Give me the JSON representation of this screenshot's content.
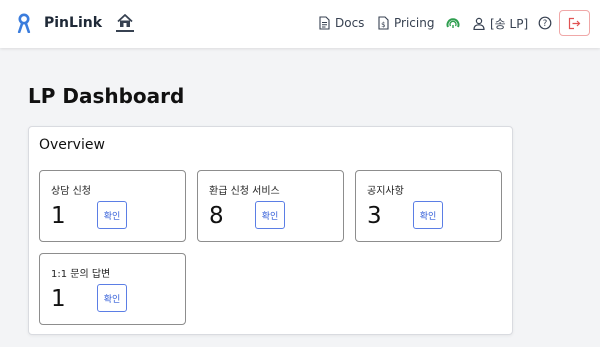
{
  "header": {
    "brand_name": "PinLink",
    "nav": {
      "docs_label": "Docs",
      "pricing_label": "Pricing",
      "user_label": "[송 LP]"
    }
  },
  "main": {
    "page_title": "LP Dashboard",
    "overview": {
      "title": "Overview",
      "cards": [
        {
          "label": "상담 신청",
          "count": "1",
          "button": "확인"
        },
        {
          "label": "환급 신청 서비스",
          "count": "8",
          "button": "확인"
        },
        {
          "label": "공지사항",
          "count": "3",
          "button": "확인"
        },
        {
          "label": "1:1 문의 답변",
          "count": "1",
          "button": "확인"
        }
      ]
    }
  },
  "colors": {
    "brand_blue": "#3b7ddd",
    "status_green": "#2e9e4f",
    "logout_red": "#e05252",
    "button_blue": "#2f5bd8"
  },
  "icons": [
    "pinlink-logo-icon",
    "home-icon",
    "document-icon",
    "pricing-icon",
    "status-icon",
    "user-icon",
    "help-icon",
    "logout-icon"
  ]
}
